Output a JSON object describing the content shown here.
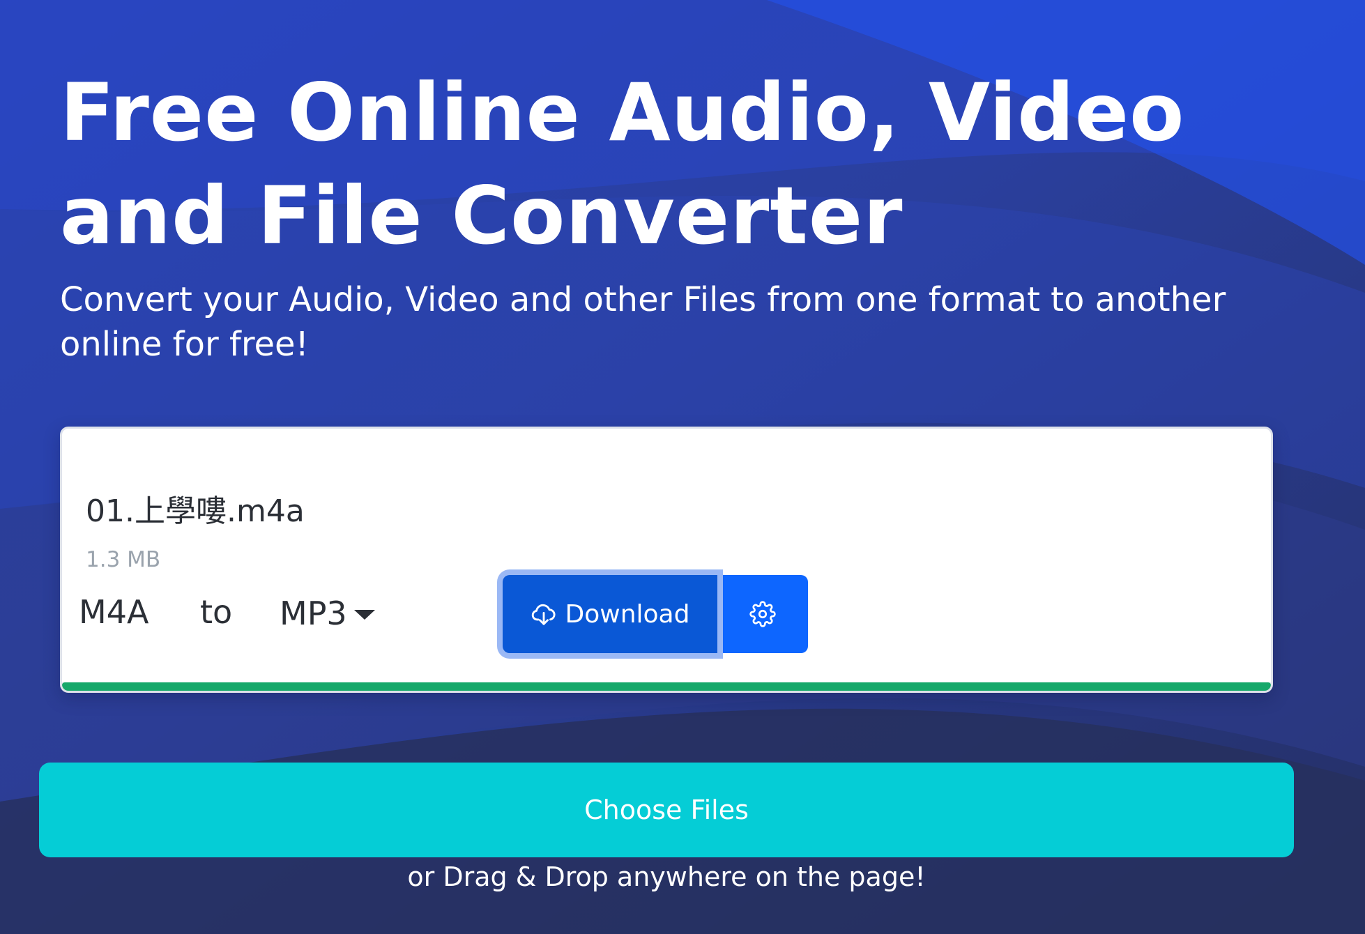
{
  "hero": {
    "title": "Free Online Audio, Video and File Converter",
    "subtitle": "Convert your Audio, Video and other Files from one format to another online for free!"
  },
  "file_card": {
    "file_name": "01.上學嘍.m4a",
    "file_size": "1.3 MB",
    "from_format": "M4A",
    "to_label": "to",
    "to_format": "MP3",
    "download_label": "Download",
    "download_icon": "cloud-download-icon",
    "settings_icon": "gear-icon",
    "progress_percent": 100
  },
  "upload": {
    "choose_files_label": "Choose Files",
    "drag_hint": "or Drag & Drop anywhere on the page!"
  },
  "colors": {
    "hero_background": "#2a3f9d",
    "hero_background_accent": "#2a4fe0",
    "download_button": "#0a58d6",
    "settings_button": "#0d66ff",
    "choose_files_button": "#05cdd6",
    "progress_fill": "#16a86a"
  }
}
